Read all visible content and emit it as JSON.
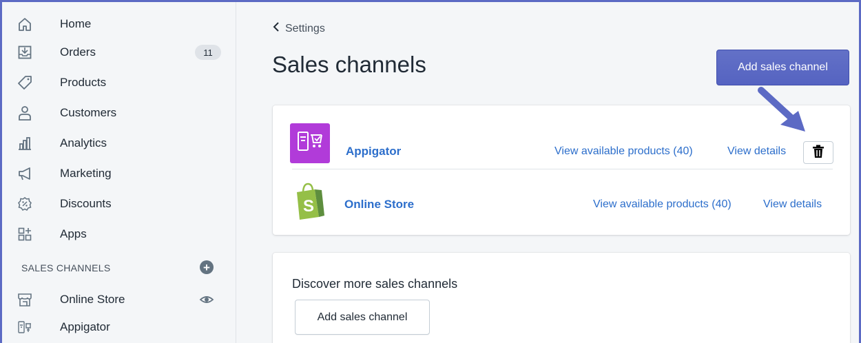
{
  "sidebar": {
    "items": [
      {
        "label": "Home",
        "icon": "home-icon"
      },
      {
        "label": "Orders",
        "icon": "orders-icon",
        "badge": "11"
      },
      {
        "label": "Products",
        "icon": "tag-icon"
      },
      {
        "label": "Customers",
        "icon": "person-icon"
      },
      {
        "label": "Analytics",
        "icon": "bar-chart-icon"
      },
      {
        "label": "Marketing",
        "icon": "megaphone-icon"
      },
      {
        "label": "Discounts",
        "icon": "discount-icon"
      },
      {
        "label": "Apps",
        "icon": "apps-icon"
      }
    ],
    "section_label": "SALES CHANNELS",
    "channels": [
      {
        "label": "Online Store",
        "icon": "store-icon"
      },
      {
        "label": "Appigator",
        "icon": "appigator-icon"
      }
    ]
  },
  "main": {
    "breadcrumb": "Settings",
    "title": "Sales channels",
    "add_button": "Add sales channel",
    "channels": [
      {
        "name": "Appigator",
        "products_link": "View available products (40)",
        "details_link": "View details"
      },
      {
        "name": "Online Store",
        "products_link": "View available products (40)",
        "details_link": "View details"
      }
    ],
    "discover": {
      "heading": "Discover more sales channels",
      "button": "Add sales channel"
    }
  },
  "colors": {
    "accent": "#5c6ac4",
    "link": "#2c6ecb",
    "appigator": "#b13bd9",
    "shopify": "#95bf47"
  }
}
